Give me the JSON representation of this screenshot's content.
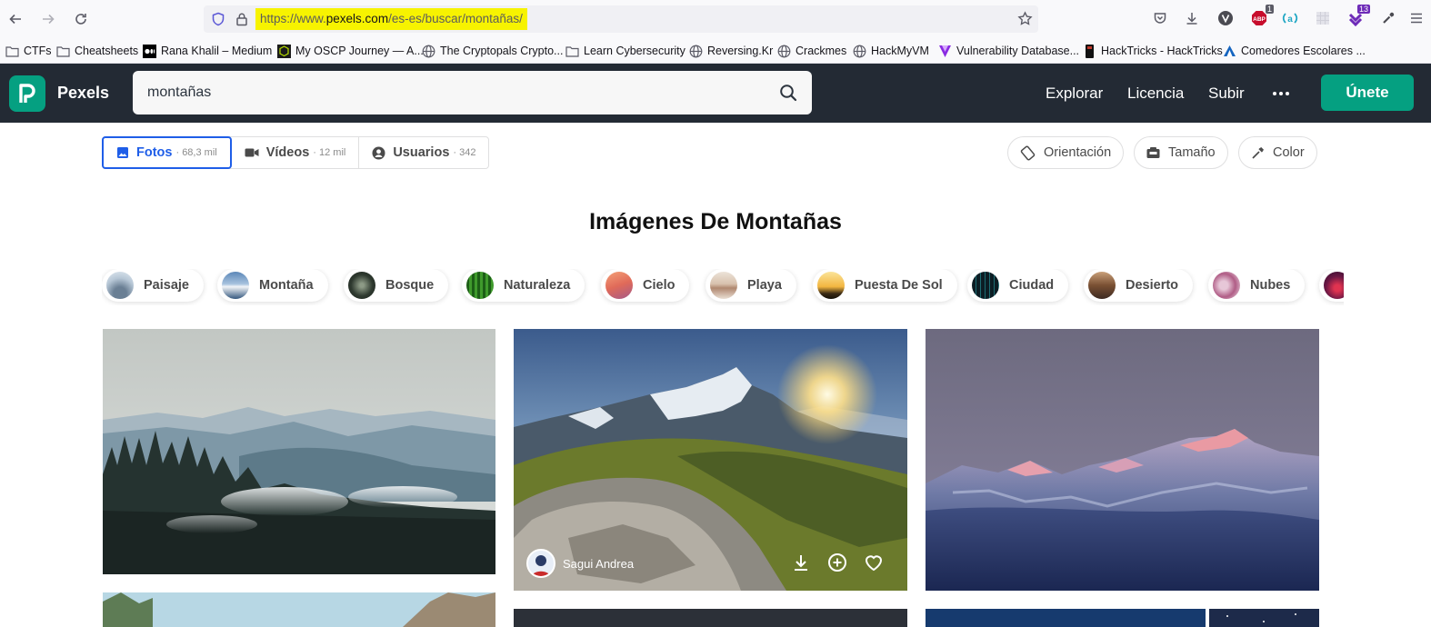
{
  "browser": {
    "url_scheme": "https://www.",
    "url_domain": "pexels.com",
    "url_path": "/es-es/buscar/montañas/",
    "bookmarks": [
      {
        "label": "CTFs",
        "icon": "folder-icon"
      },
      {
        "label": "Cheatsheets",
        "icon": "folder-icon"
      },
      {
        "label": "Rana Khalil – Medium",
        "icon": "medium-icon"
      },
      {
        "label": "My OSCP Journey — A...",
        "icon": "cube-icon"
      },
      {
        "label": "The Cryptopals Crypto...",
        "icon": "globe-icon"
      },
      {
        "label": "Learn Cybersecurity",
        "icon": "folder-icon"
      },
      {
        "label": "Reversing.Kr",
        "icon": "globe-icon"
      },
      {
        "label": "Crackmes",
        "icon": "globe-icon"
      },
      {
        "label": "HackMyVM",
        "icon": "globe-icon"
      },
      {
        "label": "Vulnerability Database...",
        "icon": "vuln-icon"
      },
      {
        "label": "HackTricks - HackTricks",
        "icon": "hacktricks-icon"
      },
      {
        "label": "Comedores Escolares ...",
        "icon": "comedores-icon"
      }
    ],
    "extension_badges": {
      "abp": "1",
      "ext13": "13"
    }
  },
  "header": {
    "logo": "Pexels",
    "search_value": "montañas",
    "nav": [
      "Explorar",
      "Licencia",
      "Subir"
    ],
    "join_label": "Únete"
  },
  "filters": {
    "tabs": [
      {
        "label": "Fotos",
        "count": "· 68,3 mil",
        "icon": "image-icon"
      },
      {
        "label": "Vídeos",
        "count": "· 12 mil",
        "icon": "video-icon"
      },
      {
        "label": "Usuarios",
        "count": "· 342",
        "icon": "user-icon"
      }
    ],
    "buttons": [
      {
        "label": "Orientación",
        "icon": "orientation-icon"
      },
      {
        "label": "Tamaño",
        "icon": "size-icon"
      },
      {
        "label": "Color",
        "icon": "eyedropper-icon"
      }
    ]
  },
  "page_title": "Imágenes De Montañas",
  "chips": [
    "Paisaje",
    "Montaña",
    "Bosque",
    "Naturaleza",
    "Cielo",
    "Playa",
    "Puesta De Sol",
    "Ciudad",
    "Desierto",
    "Nubes"
  ],
  "photos": {
    "featured_author": "Sagui Andrea"
  },
  "colors": {
    "brand": "#05a081",
    "header_bg": "#232a34",
    "active_tab": "#1f5ee8",
    "url_highlight": "#f7f300"
  }
}
